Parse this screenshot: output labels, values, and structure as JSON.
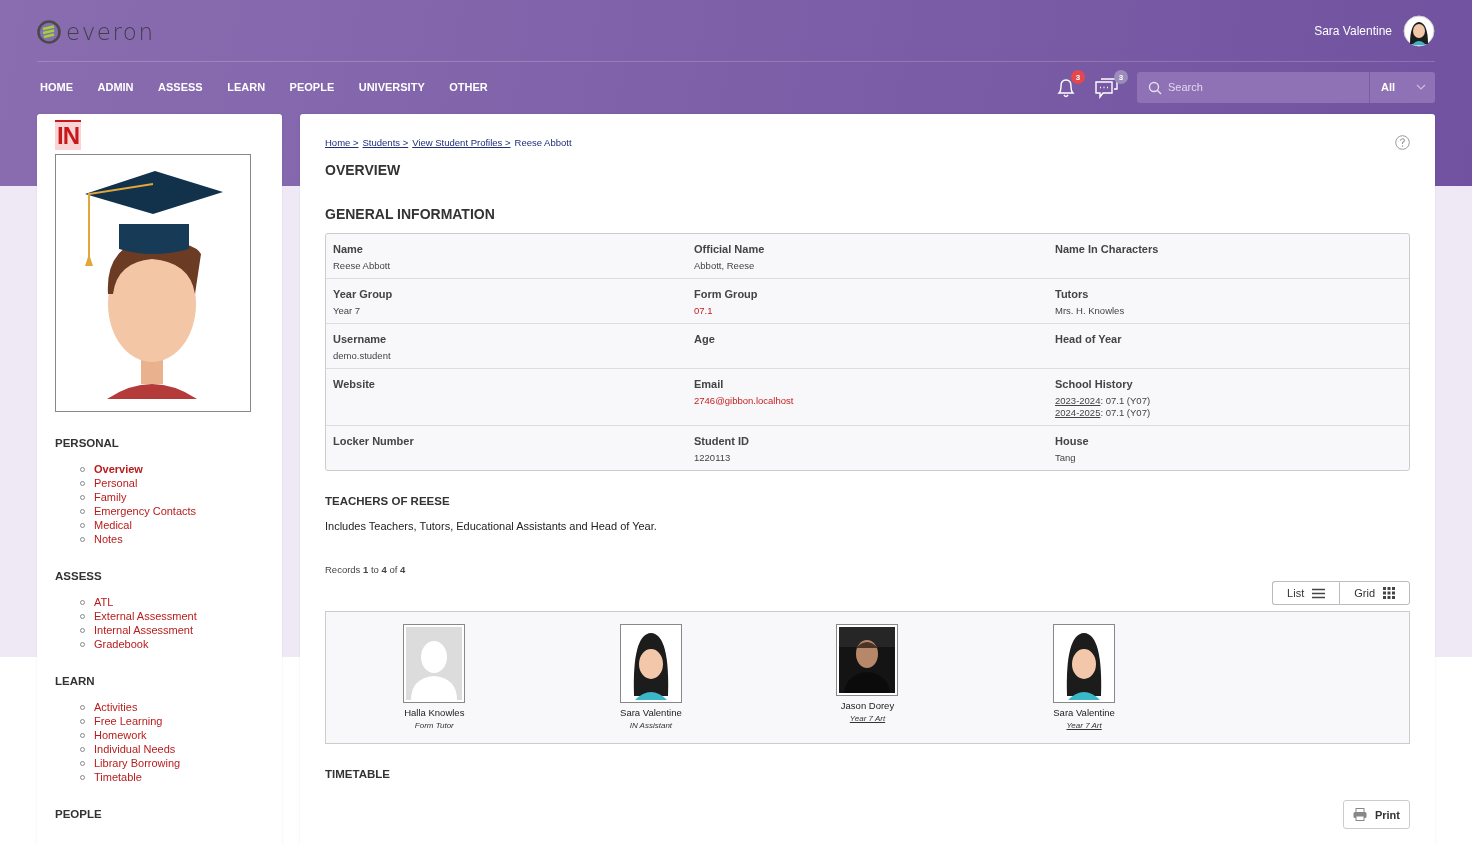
{
  "header": {
    "logo": "everon",
    "user_name": "Sara Valentine",
    "nav": [
      "HOME",
      "ADMIN",
      "ASSESS",
      "LEARN",
      "PEOPLE",
      "UNIVERSITY",
      "OTHER"
    ],
    "notifications": "3",
    "messages": "3",
    "search": {
      "placeholder": "Search",
      "scope": "All"
    }
  },
  "sidebar": {
    "badge": "IN",
    "sections": [
      {
        "title": "PERSONAL",
        "items": [
          {
            "label": "Overview",
            "selected": true
          },
          {
            "label": "Personal",
            "selected": false
          },
          {
            "label": "Family",
            "selected": false
          },
          {
            "label": "Emergency Contacts",
            "selected": false
          },
          {
            "label": "Medical",
            "selected": false
          },
          {
            "label": "Notes",
            "selected": false
          }
        ]
      },
      {
        "title": "ASSESS",
        "items": [
          {
            "label": "ATL",
            "selected": false
          },
          {
            "label": "External Assessment",
            "selected": false
          },
          {
            "label": "Internal Assessment",
            "selected": false
          },
          {
            "label": "Gradebook",
            "selected": false
          }
        ]
      },
      {
        "title": "LEARN",
        "items": [
          {
            "label": "Activities",
            "selected": false
          },
          {
            "label": "Free Learning",
            "selected": false
          },
          {
            "label": "Homework",
            "selected": false
          },
          {
            "label": "Individual Needs",
            "selected": false
          },
          {
            "label": "Library Borrowing",
            "selected": false
          },
          {
            "label": "Timetable",
            "selected": false
          }
        ]
      },
      {
        "title": "PEOPLE"
      }
    ]
  },
  "main": {
    "breadcrumbs": [
      {
        "label": "Home >",
        "link": true
      },
      {
        "label": "Students >",
        "link": true
      },
      {
        "label": "View Student Profiles >",
        "link": true
      },
      {
        "label": "Reese Abbott",
        "link": false
      }
    ],
    "title": "OVERVIEW",
    "general_heading": "GENERAL INFORMATION",
    "info_rows": [
      [
        {
          "label": "Name",
          "value": "Reese Abbott"
        },
        {
          "label": "Official Name",
          "value": "Abbott, Reese"
        },
        {
          "label": "Name In Characters"
        }
      ],
      [
        {
          "label": "Year Group",
          "value": "Year 7"
        },
        {
          "label": "Form Group",
          "value": "07.1",
          "link": true
        },
        {
          "label": "Tutors",
          "value": "Mrs. H. Knowles"
        }
      ],
      [
        {
          "label": "Username",
          "value": "demo.student"
        },
        {
          "label": "Age"
        },
        {
          "label": "Head of Year"
        }
      ],
      [
        {
          "label": "Website"
        },
        {
          "label": "Email",
          "value": "2746@gibbon.localhost",
          "link": true
        },
        {
          "label": "School History",
          "history": [
            {
              "year": "2023-2024",
              "detail": ": 07.1 (Y07)"
            },
            {
              "year": "2024-2025",
              "detail": ": 07.1 (Y07)"
            }
          ]
        }
      ],
      [
        {
          "label": "Locker Number"
        },
        {
          "label": "Student ID",
          "value": "1220113"
        },
        {
          "label": "House",
          "value": "Tang"
        }
      ]
    ],
    "teachers_heading": "TEACHERS OF REESE",
    "teachers_note": "Includes Teachers, Tutors, Educational Assistants and Head of Year.",
    "records": "Records **1** to **4** of **4**",
    "view_buttons": [
      {
        "kind": "list",
        "label": "List"
      },
      {
        "kind": "grid",
        "label": "Grid"
      }
    ],
    "teachers": [
      {
        "kind": "placeholder",
        "name": "Halla Knowles",
        "role": "Form Tutor",
        "role_link": false
      },
      {
        "kind": "avatar",
        "name": "Sara Valentine",
        "role": "IN Assistant",
        "role_link": false
      },
      {
        "name": "Jason Dorey",
        "role": "Year 7 Art",
        "role_link": true
      },
      {
        "kind": "avatar",
        "name": "Sara Valentine",
        "role": "Year 7 Art",
        "role_link": true
      }
    ],
    "timetable_heading": "TIMETABLE",
    "print_button": "Print"
  }
}
